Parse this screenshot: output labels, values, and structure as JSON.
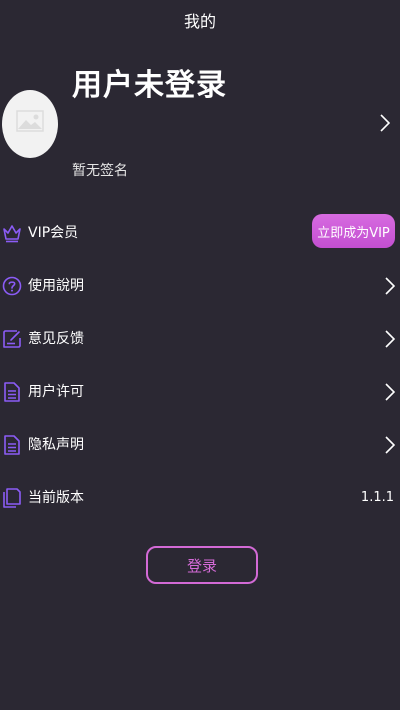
{
  "header": {
    "title": "我的"
  },
  "profile": {
    "name": "用户未登录",
    "signature": "暂无签名",
    "avatar_icon": "image-placeholder-icon"
  },
  "menu": {
    "items": [
      {
        "label": "VIP会员",
        "icon": "crown-icon",
        "action_label": "立即成为VIP"
      },
      {
        "label": "使用說明",
        "icon": "question-circle-icon"
      },
      {
        "label": "意见反馈",
        "icon": "edit-icon"
      },
      {
        "label": "用户许可",
        "icon": "document-icon"
      },
      {
        "label": "隐私声明",
        "icon": "document-icon"
      },
      {
        "label": "当前版本",
        "icon": "copy-icon",
        "value": "1.1.1"
      }
    ]
  },
  "login": {
    "label": "登录"
  },
  "colors": {
    "background": "#2b2833",
    "accent": "#d36ad6",
    "icon": "#8b5cf6"
  }
}
